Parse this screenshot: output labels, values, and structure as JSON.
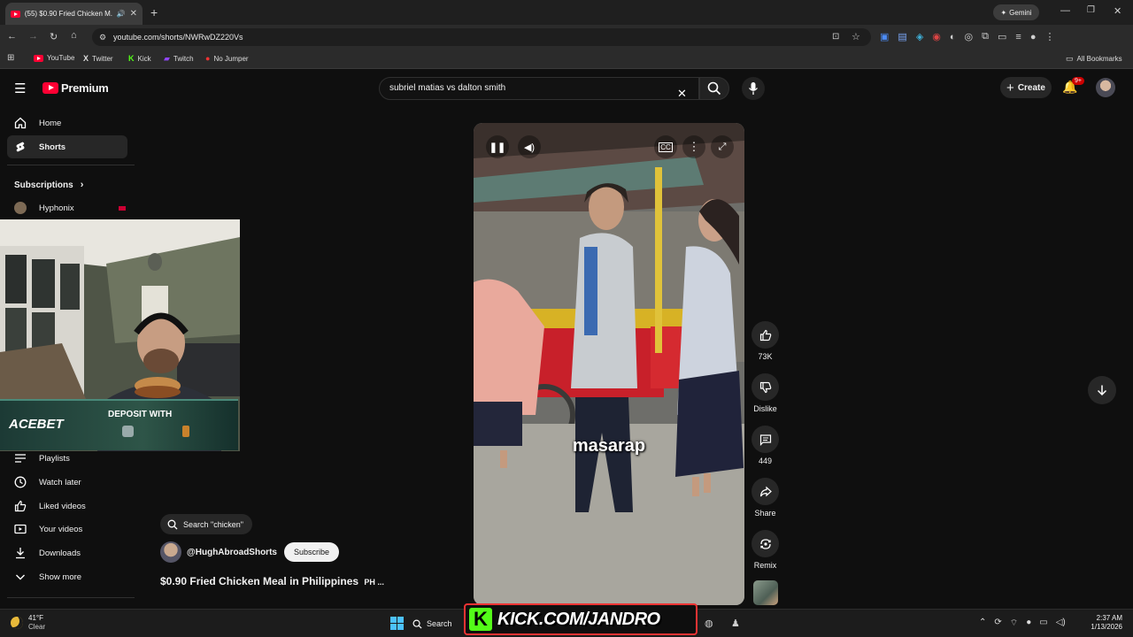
{
  "browser": {
    "tab_title": "(55) $0.90 Fried Chicken M...",
    "gemini_label": "Gemini",
    "url": "youtube.com/shorts/NWRwDZ220Vs",
    "bookmarks": [
      "YouTube",
      "Twitter",
      "Kick",
      "Twitch",
      "No Jumper"
    ],
    "all_bookmarks": "All Bookmarks"
  },
  "youtube": {
    "logo_text": "Premium",
    "search_query": "subriel matias vs dalton smith",
    "create_label": "Create",
    "notif_badge": "9+"
  },
  "sidebar": {
    "top_items": [
      {
        "label": "Home",
        "icon": "home-icon"
      },
      {
        "label": "Shorts",
        "icon": "shorts-icon"
      }
    ],
    "subscriptions_header": "Subscriptions",
    "subscription": "Hyphonix",
    "you_items": [
      {
        "label": "Playlists",
        "icon": "playlists-icon"
      },
      {
        "label": "Watch later",
        "icon": "clock-icon"
      },
      {
        "label": "Liked videos",
        "icon": "thumbs-up-icon"
      },
      {
        "label": "Your videos",
        "icon": "video-icon"
      },
      {
        "label": "Downloads",
        "icon": "download-icon"
      },
      {
        "label": "Show more",
        "icon": "chevron-down-icon"
      }
    ]
  },
  "overlay": {
    "acebet": "ACEBET",
    "deposit": "DEPOSIT WITH"
  },
  "short": {
    "search_chip": "Search \"chicken\"",
    "channel": "@HughAbroadShorts",
    "subscribe": "Subscribe",
    "title": "$0.90 Fried Chicken Meal in Philippines",
    "title_suffix": "PH ...",
    "caption": "masarap",
    "actions": {
      "likes": "73K",
      "dislike": "Dislike",
      "comments": "449",
      "share": "Share",
      "remix": "Remix"
    }
  },
  "taskbar": {
    "temp": "41°F",
    "weather": "Clear",
    "search": "Search",
    "kick_banner": "KICK.COM/JANDRO",
    "time": "2:37 AM",
    "date": "1/13/2026"
  }
}
